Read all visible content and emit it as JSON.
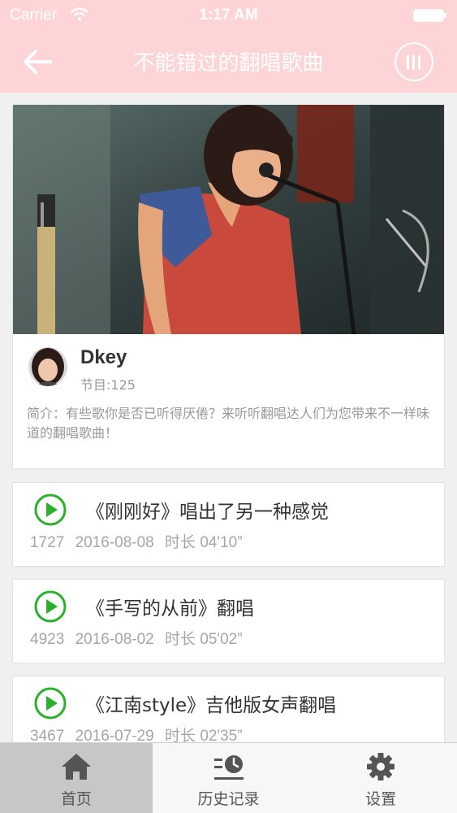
{
  "status_bar": {
    "carrier": "Carrier",
    "time": "1:17 AM"
  },
  "nav": {
    "title": "不能错过的翻唱歌曲",
    "back_icon": "arrow-left-icon",
    "player_icon": "equalizer-bars-icon"
  },
  "album": {
    "author": "Dkey",
    "program_count": "节目:125",
    "intro": "简介：有些歌你是否已听得厌倦？来听听翻唱达人们为您带来不一样味道的翻唱歌曲！"
  },
  "songs": [
    {
      "title": "《刚刚好》唱出了另一种感觉",
      "plays": "1727",
      "date": "2016-08-08",
      "duration": "时长 04'10”"
    },
    {
      "title": "《手写的从前》翻唱",
      "plays": "4923",
      "date": "2016-08-02",
      "duration": "时长 05'02”"
    },
    {
      "title": "《江南style》吉他版女声翻唱",
      "plays": "3467",
      "date": "2016-07-29",
      "duration": "时长 02'35”"
    }
  ],
  "tabs": [
    {
      "label": "首页",
      "icon": "home-icon",
      "active": true
    },
    {
      "label": "历史记录",
      "icon": "history-clock-icon",
      "active": false
    },
    {
      "label": "设置",
      "icon": "gear-icon",
      "active": false
    }
  ],
  "colors": {
    "nav_bg": "#fdd5d7",
    "play_green": "#2bb02b",
    "muted_text": "#a6a6a6"
  }
}
